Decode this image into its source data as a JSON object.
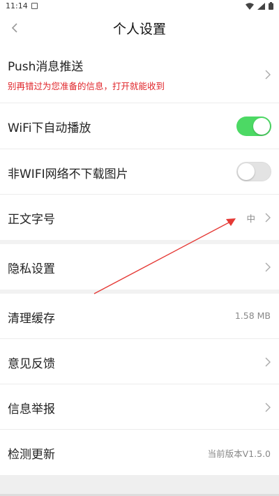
{
  "status_bar": {
    "time": "11:14"
  },
  "header": {
    "title": "个人设置"
  },
  "settings": {
    "push": {
      "label": "Push消息推送",
      "sub": "别再错过为您准备的信息，打开就能收到"
    },
    "wifi_autoplay": {
      "label": "WiFi下自动播放",
      "toggle": "on"
    },
    "non_wifi_images": {
      "label": "非WIFI网络不下载图片",
      "toggle": "off"
    },
    "font_size": {
      "label": "正文字号",
      "value": "中"
    },
    "privacy": {
      "label": "隐私设置"
    },
    "clear_cache": {
      "label": "清理缓存",
      "value": "1.58 MB"
    },
    "feedback": {
      "label": "意见反馈"
    },
    "report": {
      "label": "信息举报"
    },
    "update": {
      "label": "检测更新",
      "value": "当前版本V1.5.0"
    }
  },
  "colors": {
    "toggle_on": "#4cd964",
    "subtitle_red": "#e0262b",
    "annotation_arrow": "#e53935"
  }
}
